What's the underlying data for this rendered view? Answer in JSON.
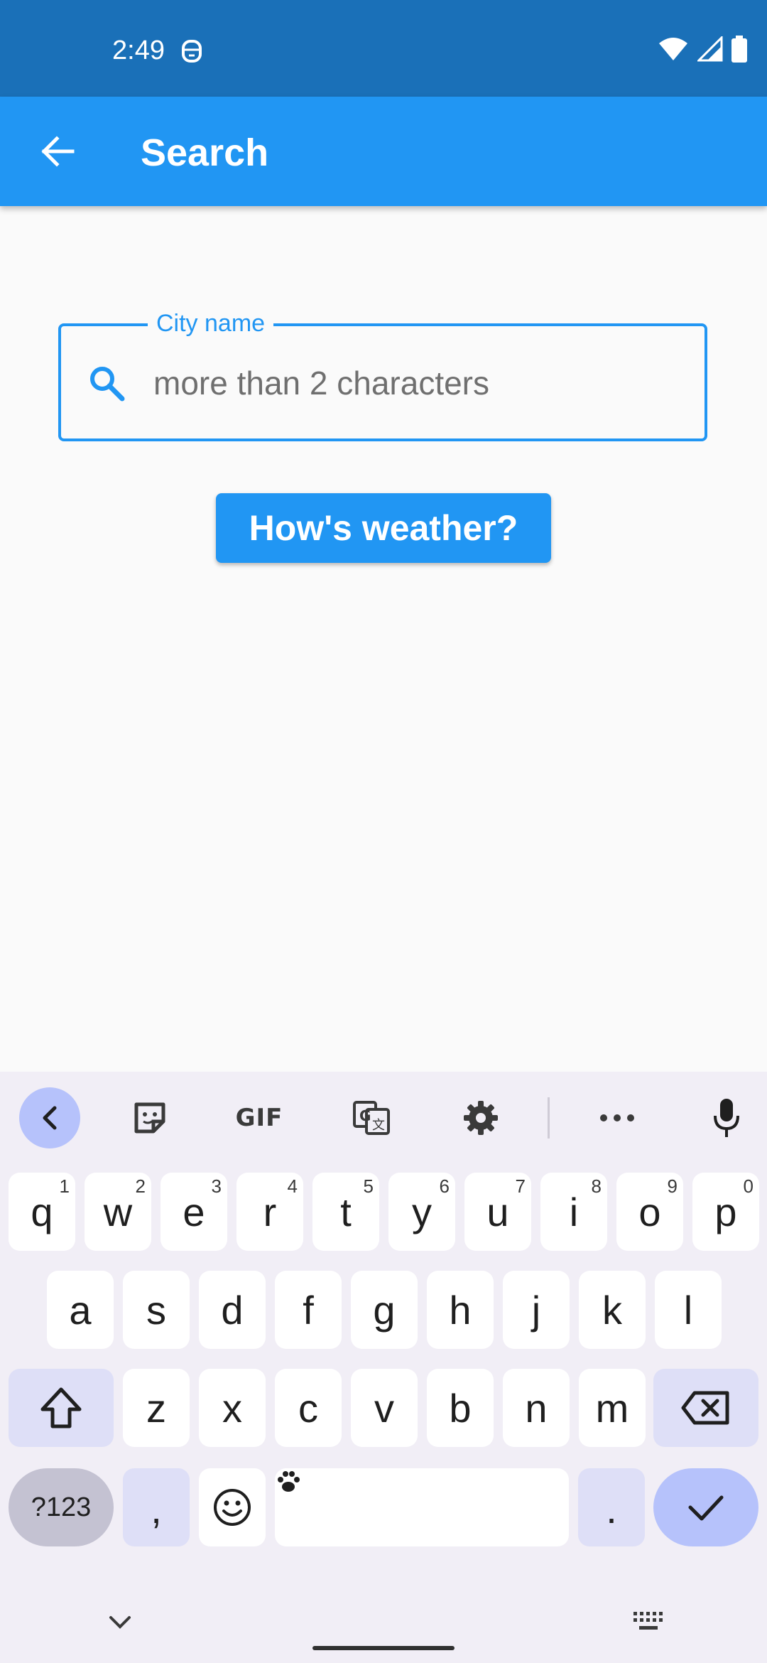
{
  "status_bar": {
    "time": "2:49"
  },
  "app_bar": {
    "title": "Search"
  },
  "search_field": {
    "label": "City name",
    "placeholder": "more than 2 characters",
    "value": ""
  },
  "action_button": {
    "label": "How's weather?"
  },
  "colors": {
    "primary": "#2196f3",
    "status_bar": "#1a70b8",
    "keyboard_bg": "#f1eef6"
  },
  "keyboard": {
    "toolbar_gif": "GIF",
    "row1": [
      {
        "label": "q",
        "hint": "1"
      },
      {
        "label": "w",
        "hint": "2"
      },
      {
        "label": "e",
        "hint": "3"
      },
      {
        "label": "r",
        "hint": "4"
      },
      {
        "label": "t",
        "hint": "5"
      },
      {
        "label": "y",
        "hint": "6"
      },
      {
        "label": "u",
        "hint": "7"
      },
      {
        "label": "i",
        "hint": "8"
      },
      {
        "label": "o",
        "hint": "9"
      },
      {
        "label": "p",
        "hint": "0"
      }
    ],
    "row2": [
      "a",
      "s",
      "d",
      "f",
      "g",
      "h",
      "j",
      "k",
      "l"
    ],
    "row3": [
      "z",
      "x",
      "c",
      "v",
      "b",
      "n",
      "m"
    ],
    "symbols": "?123",
    "comma": ",",
    "period": "."
  }
}
